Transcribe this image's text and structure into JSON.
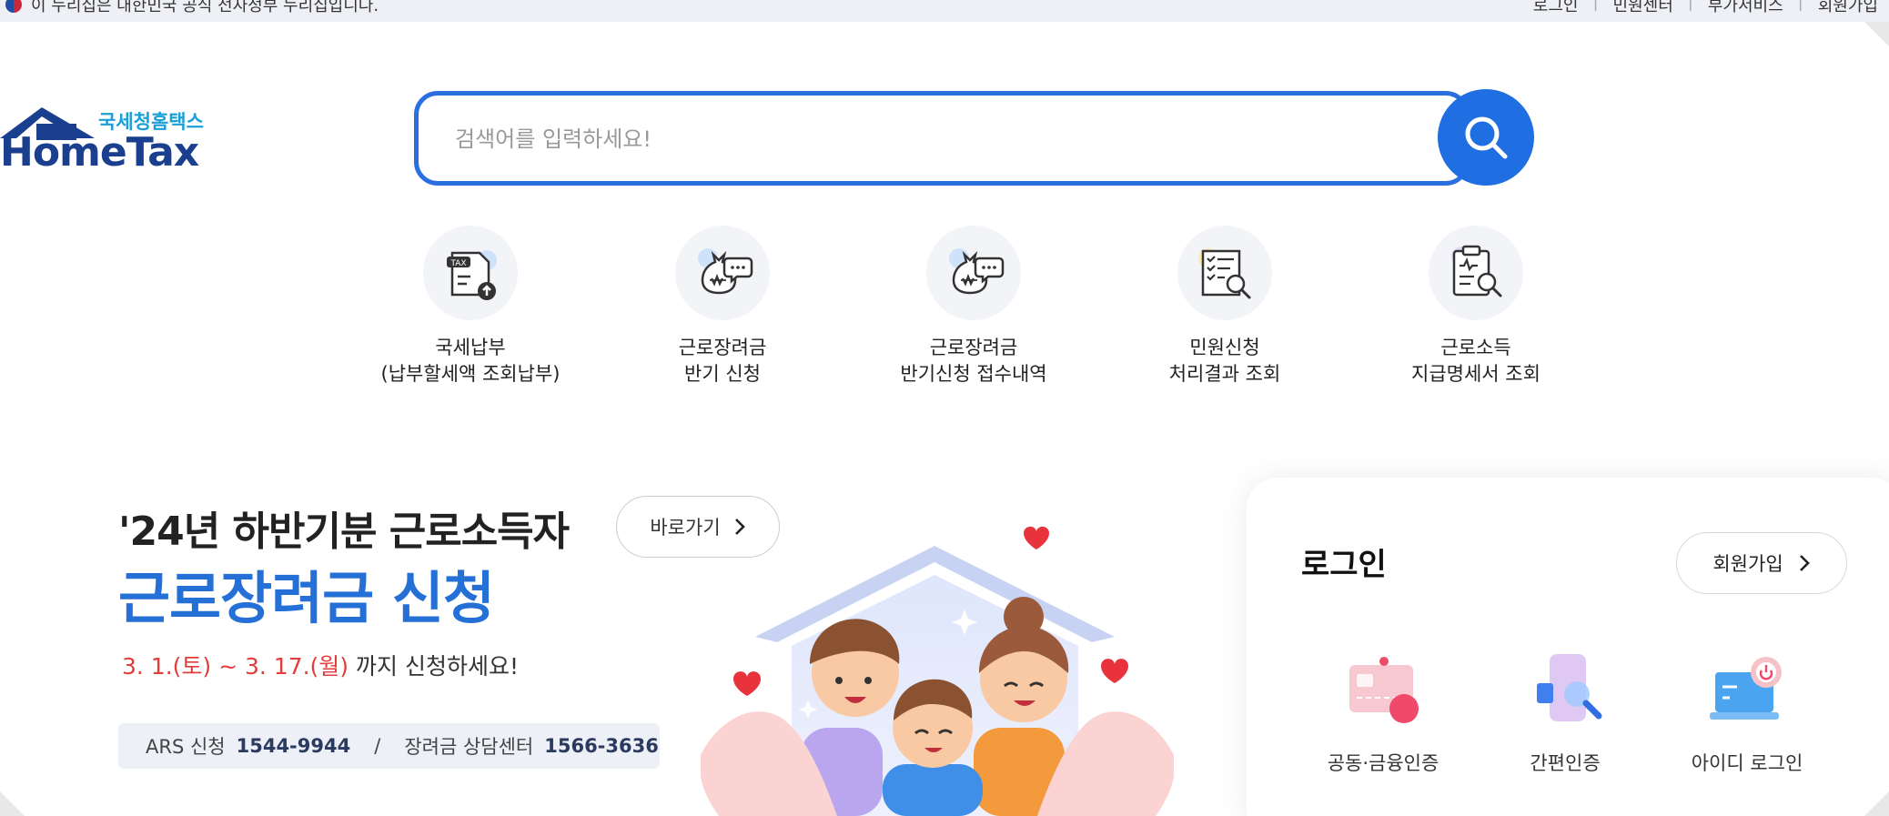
{
  "topbar": {
    "notice": "이 누리집은 대한민국 공식 전자정부 누리집입니다.",
    "links": [
      "로그인",
      "민원센터",
      "부가서비스",
      "회원가입"
    ]
  },
  "logo": {
    "korean": "국세청홈택스",
    "english": "HomeTax"
  },
  "search": {
    "placeholder": "검색어를 입력하세요!",
    "button_icon": "search-icon"
  },
  "quick_menu": [
    {
      "label": "국세납부\n(납부할세액 조회납부)",
      "icon": "tax-upload-icon"
    },
    {
      "label": "근로장려금\n반기 신청",
      "icon": "money-bag-chat-icon"
    },
    {
      "label": "근로장려금\n반기신청 접수내역",
      "icon": "money-bag-chat-icon"
    },
    {
      "label": "민원신청\n처리결과 조회",
      "icon": "document-search-icon"
    },
    {
      "label": "근로소득\n지급명세서 조회",
      "icon": "clipboard-search-icon"
    }
  ],
  "banner": {
    "title_line1": "'24년 하반기분 근로소득자",
    "title_line2": "근로장려금 신청",
    "goto_label": "바로가기",
    "date_red": "3. 1.(토) ~ 3. 17.(월)",
    "date_rest": " 까지 신청하세요!",
    "ars_label": "ARS 신청",
    "ars_number": "1544-9944",
    "divider": "/",
    "center_label": "장려금 상담센터",
    "center_number": "1566-3636"
  },
  "login": {
    "title": "로그인",
    "join_label": "회원가입",
    "options": [
      {
        "label": "공동·금융인증",
        "icon": "certificate-card-icon"
      },
      {
        "label": "간편인증",
        "icon": "phone-search-icon"
      },
      {
        "label": "아이디 로그인",
        "icon": "laptop-power-icon"
      }
    ]
  },
  "colors": {
    "primary": "#1f6fe3",
    "logo_blue": "#1a3f8f",
    "logo_cyan": "#1a9fd6",
    "accent_red": "#e23c3c"
  }
}
